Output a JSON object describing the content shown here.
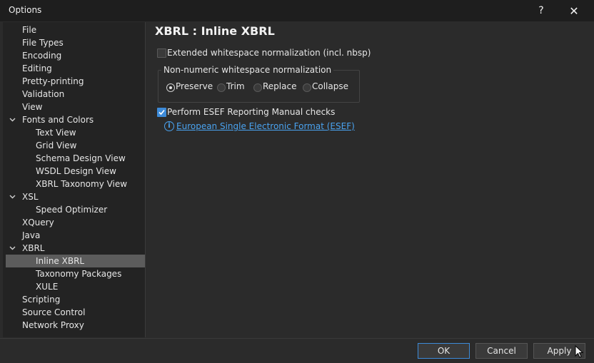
{
  "window": {
    "title": "Options",
    "help_glyph": "?",
    "close_glyph": "✕"
  },
  "tree": [
    {
      "label": "File",
      "level": 0
    },
    {
      "label": "File Types",
      "level": 0
    },
    {
      "label": "Encoding",
      "level": 0
    },
    {
      "label": "Editing",
      "level": 0
    },
    {
      "label": "Pretty-printing",
      "level": 0
    },
    {
      "label": "Validation",
      "level": 0
    },
    {
      "label": "View",
      "level": 0
    },
    {
      "label": "Fonts and Colors",
      "level": 0,
      "expanded": true
    },
    {
      "label": "Text View",
      "level": 1
    },
    {
      "label": "Grid View",
      "level": 1
    },
    {
      "label": "Schema Design View",
      "level": 1
    },
    {
      "label": "WSDL Design View",
      "level": 1
    },
    {
      "label": "XBRL Taxonomy View",
      "level": 1
    },
    {
      "label": "XSL",
      "level": 0,
      "expanded": true
    },
    {
      "label": "Speed Optimizer",
      "level": 1
    },
    {
      "label": "XQuery",
      "level": 0
    },
    {
      "label": "Java",
      "level": 0
    },
    {
      "label": "XBRL",
      "level": 0,
      "expanded": true
    },
    {
      "label": "Inline XBRL",
      "level": 1,
      "selected": true
    },
    {
      "label": "Taxonomy Packages",
      "level": 1
    },
    {
      "label": "XULE",
      "level": 1
    },
    {
      "label": "Scripting",
      "level": 0
    },
    {
      "label": "Source Control",
      "level": 0
    },
    {
      "label": "Network Proxy",
      "level": 0
    }
  ],
  "content": {
    "title": "XBRL : Inline XBRL",
    "extended_ws": {
      "label": "Extended whitespace normalization (incl. nbsp)",
      "checked": false
    },
    "ws_group": {
      "legend": "Non-numeric whitespace normalization",
      "options": [
        "Preserve",
        "Trim",
        "Replace",
        "Collapse"
      ],
      "selected": "Preserve"
    },
    "esef_check": {
      "label": "Perform ESEF Reporting Manual checks",
      "checked": true
    },
    "esef_link": "European Single Electronic Format (ESEF)",
    "info_glyph": "i"
  },
  "buttons": {
    "ok": "OK",
    "cancel": "Cancel",
    "apply": "Apply"
  },
  "colors": {
    "accent": "#3d8bd9",
    "link": "#4aa3f0",
    "selection": "#5c5c5c"
  }
}
